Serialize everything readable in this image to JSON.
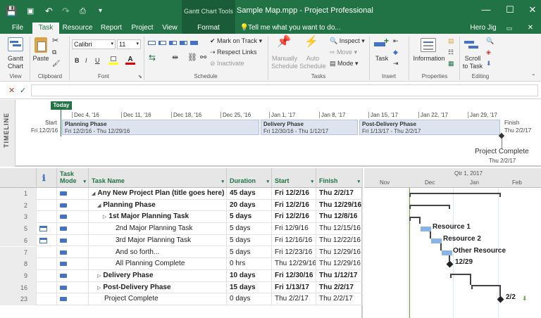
{
  "titlebar": {
    "context_label": "Gantt Chart Tools",
    "doc_title": "Sample Map.mpp - Project Professional",
    "qa_save": "💾",
    "qa_undo": "↶",
    "qa_redo": "↷",
    "minimize": "—",
    "restore": "☐",
    "close": "✕"
  },
  "tabs": [
    {
      "label": "File"
    },
    {
      "label": "Task"
    },
    {
      "label": "Resource"
    },
    {
      "label": "Report"
    },
    {
      "label": "Project"
    },
    {
      "label": "View"
    },
    {
      "label": "Format"
    }
  ],
  "tell_me": "Tell me what you want to do...",
  "user": "Hero Jig",
  "ribbon": {
    "view_group": {
      "btn": "Gantt\nChart",
      "label": "View"
    },
    "clipboard_group": {
      "paste": "Paste",
      "label": "Clipboard"
    },
    "font_group": {
      "font_name": "Calibri",
      "font_size": "11",
      "bold": "B",
      "italic": "I",
      "underline": "U",
      "label": "Font"
    },
    "schedule_group": {
      "mark_on_track": "Mark on Track",
      "respect_links": "Respect Links",
      "inactivate": "Inactivate",
      "label": "Schedule"
    },
    "tasks_group": {
      "manually": "Manually\nSchedule",
      "auto": "Auto\nSchedule",
      "inspect": "Inspect",
      "move": "Move",
      "mode": "Mode",
      "label": "Tasks"
    },
    "insert_group": {
      "task": "Task",
      "label": "Insert"
    },
    "properties_group": {
      "information": "Information",
      "label": "Properties"
    },
    "editing_group": {
      "scroll": "Scroll\nto Task",
      "label": "Editing"
    }
  },
  "timeline": {
    "label": "TIMELINE",
    "today": "Today",
    "start_label": "Start",
    "start_date": "Fri 12/2/16",
    "finish_label": "Finish",
    "finish_date": "Thu 2/2/17",
    "dates": [
      "Dec 4, '16",
      "Dec 11, '16",
      "Dec 18, '16",
      "Dec 25, '16",
      "Jan 1, '17",
      "Jan 8, '17",
      "Jan 15, '17",
      "Jan 22, '17",
      "Jan 29, '17"
    ],
    "phases": [
      {
        "name": "Planning Phase",
        "dates": "Fri 12/2/16 - Thu 12/29/16"
      },
      {
        "name": "Delivery Phase",
        "dates": "Fri 12/30/16 - Thu 1/12/17"
      },
      {
        "name": "Post-Delivery Phase",
        "dates": "Fri 1/13/17 - Thu 2/2/17"
      }
    ],
    "milestone_name": "Project Complete",
    "milestone_date": "Thu 2/2/17"
  },
  "grid": {
    "headers": {
      "info": "ℹ",
      "mode": "Task\nMode",
      "name": "Task Name",
      "duration": "Duration",
      "start": "Start",
      "finish": "Finish"
    },
    "rows": [
      {
        "id": "1",
        "name": "Any New Project Plan (title goes here)",
        "duration": "45 days",
        "start": "Fri 12/2/16",
        "finish": "Thu 2/2/17",
        "bold": true,
        "indent": 0,
        "toggle": "◢",
        "info": ""
      },
      {
        "id": "2",
        "name": "Planning Phase",
        "duration": "20 days",
        "start": "Fri 12/2/16",
        "finish": "Thu 12/29/16",
        "bold": true,
        "indent": 1,
        "toggle": "◢",
        "info": ""
      },
      {
        "id": "3",
        "name": "1st Major Planning Task",
        "duration": "5 days",
        "start": "Fri 12/2/16",
        "finish": "Thu 12/8/16",
        "bold": true,
        "indent": 2,
        "toggle": "▷",
        "info": ""
      },
      {
        "id": "5",
        "name": "2nd Major Planning Task",
        "duration": "5 days",
        "start": "Fri 12/9/16",
        "finish": "Thu 12/15/16",
        "bold": false,
        "indent": 3,
        "toggle": "",
        "info": "cal"
      },
      {
        "id": "6",
        "name": "3rd Major Planning Task",
        "duration": "5 days",
        "start": "Fri 12/16/16",
        "finish": "Thu 12/22/16",
        "bold": false,
        "indent": 3,
        "toggle": "",
        "info": "cal"
      },
      {
        "id": "7",
        "name": "And so forth...",
        "duration": "5 days",
        "start": "Fri 12/23/16",
        "finish": "Thu 12/29/16",
        "bold": false,
        "indent": 3,
        "toggle": "",
        "info": ""
      },
      {
        "id": "8",
        "name": "All Planning Complete",
        "duration": "0 hrs",
        "start": "Thu 12/29/16",
        "finish": "Thu 12/29/16",
        "bold": false,
        "indent": 3,
        "toggle": "",
        "info": ""
      },
      {
        "id": "9",
        "name": "Delivery Phase",
        "duration": "10 days",
        "start": "Fri 12/30/16",
        "finish": "Thu 1/12/17",
        "bold": true,
        "indent": 1,
        "toggle": "▷",
        "info": ""
      },
      {
        "id": "16",
        "name": "Post-Delivery Phase",
        "duration": "15 days",
        "start": "Fri 1/13/17",
        "finish": "Thu 2/2/17",
        "bold": true,
        "indent": 1,
        "toggle": "▷",
        "info": ""
      },
      {
        "id": "23",
        "name": "Project Complete",
        "duration": "0 days",
        "start": "Thu 2/2/17",
        "finish": "Thu 2/2/17",
        "bold": false,
        "indent": 1,
        "toggle": "",
        "info": ""
      }
    ]
  },
  "gantt": {
    "qtr_label": "Qtr 1, 2017",
    "months": [
      "Nov",
      "Dec",
      "Jan",
      "Feb"
    ],
    "labels": {
      "resource1": "Resource 1",
      "resource2": "Resource 2",
      "other": "Other Resource",
      "planning_done": "12/29",
      "project_done": "2/2"
    }
  }
}
